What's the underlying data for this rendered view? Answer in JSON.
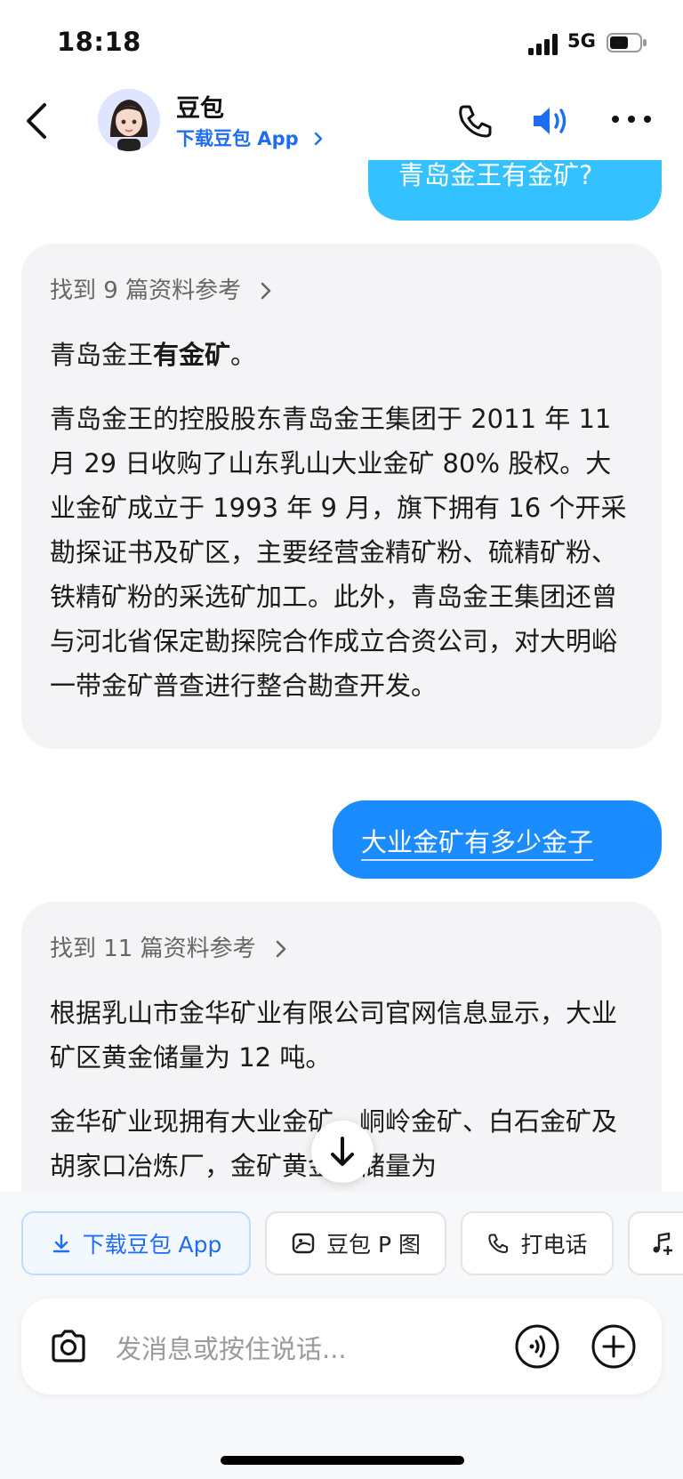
{
  "status": {
    "time": "18:18",
    "network": "5G"
  },
  "header": {
    "bot_name": "豆包",
    "download_link": "下载豆包 App"
  },
  "messages": {
    "user_1": "青岛金王有金矿?",
    "bot_1": {
      "references": "找到 9 篇资料参考",
      "lead_plain": "青岛金王",
      "lead_bold": "有金矿",
      "lead_end": "。",
      "body": "青岛金王的控股股东青岛金王集团于 2011 年 11 月 29 日收购了山东乳山大业金矿 80% 股权。大业金矿成立于 1993 年 9 月，旗下拥有 16 个开采勘探证书及矿区，主要经营金精矿粉、硫精矿粉、铁精矿粉的采选矿加工。此外，青岛金王集团还曾与河北省保定勘探院合作成立合资公司，对大明峪一带金矿普查进行整合勘查开发。"
    },
    "user_2": "大业金矿有多少金子",
    "bot_2": {
      "references": "找到 11 篇资料参考",
      "para1": "根据乳山市金华矿业有限公司官网信息显示，大业矿区黄金储量为 12 吨。",
      "para2": "金华矿业现拥有大业金矿、峒岭金矿、白石金矿及胡家口冶炼厂，金矿黄金总储量为"
    }
  },
  "chips": {
    "download": "下载豆包 App",
    "p_image": "豆包 P 图",
    "call": "打电话"
  },
  "input": {
    "placeholder": "发消息或按住说话..."
  },
  "icons": [
    "back-icon",
    "avatar",
    "phone-icon",
    "speaker-icon",
    "more-icon",
    "chevron-right-icon",
    "arrow-down-icon",
    "download-icon",
    "image-edit-icon",
    "phone-small-icon",
    "music-icon",
    "camera-icon",
    "voice-icon",
    "plus-icon"
  ],
  "colors": {
    "accent": "#1e6df2",
    "user_bubble": "#1a8cff",
    "card_bg": "#f4f4f6"
  }
}
